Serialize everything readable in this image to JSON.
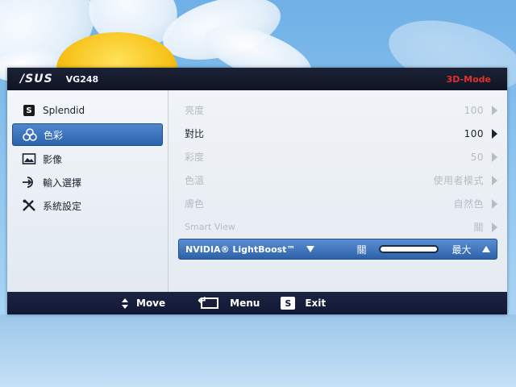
{
  "header": {
    "brand": "/SUS",
    "model": "VG248",
    "mode": "3D-Mode"
  },
  "sidebar": {
    "items": [
      {
        "label": "Splendid",
        "icon": "splendid-s-icon",
        "active": false
      },
      {
        "label": "色彩",
        "icon": "color-circles-icon",
        "active": true
      },
      {
        "label": "影像",
        "icon": "image-icon",
        "active": false
      },
      {
        "label": "輸入選擇",
        "icon": "input-icon",
        "active": false
      },
      {
        "label": "系統設定",
        "icon": "tools-icon",
        "active": false
      }
    ]
  },
  "settings": [
    {
      "label": "亮度",
      "value": "100",
      "enabled": false
    },
    {
      "label": "對比",
      "value": "100",
      "enabled": true
    },
    {
      "label": "彩度",
      "value": "50",
      "enabled": false
    },
    {
      "label": "色溫",
      "value": "使用者模式",
      "enabled": false
    },
    {
      "label": "膚色",
      "value": "自然色",
      "enabled": false
    },
    {
      "label": "Smart View",
      "value": "關",
      "enabled": false
    }
  ],
  "lightboost": {
    "label": "NVIDIA® LightBoost™",
    "min_label": "關",
    "max_label": "最大"
  },
  "footer": {
    "move": "Move",
    "menu": "Menu",
    "exit": "Exit",
    "exit_badge": "S"
  },
  "colors": {
    "accent": "#2c63ad",
    "mode_red": "#e0322c",
    "bar_dark": "#121834"
  }
}
